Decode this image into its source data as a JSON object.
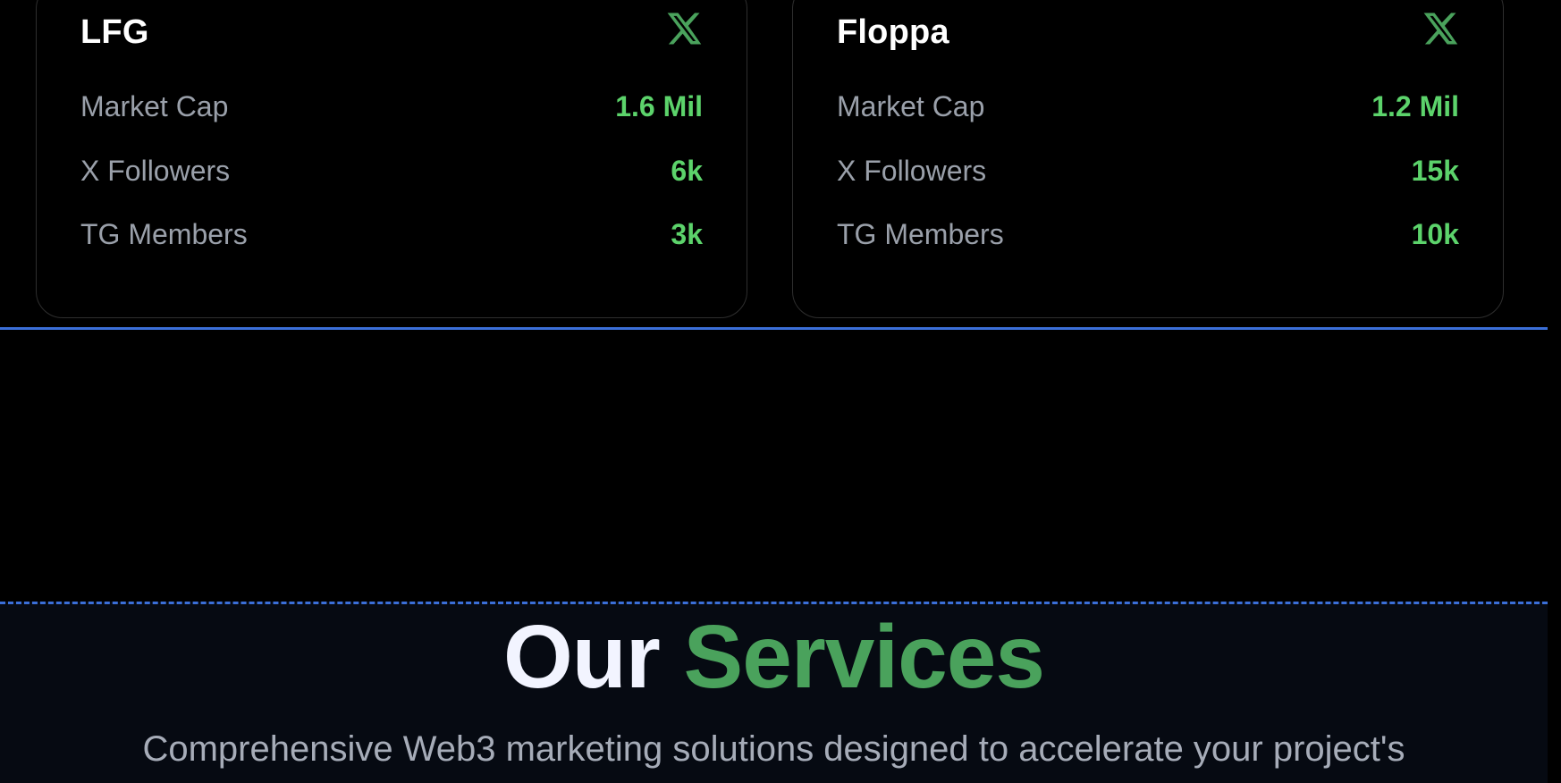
{
  "projects": [
    {
      "name": "LFG",
      "icon": "x-logo-icon",
      "stats": [
        {
          "label": "Market Cap",
          "value": "1.6 Mil"
        },
        {
          "label": "X Followers",
          "value": "6k"
        },
        {
          "label": "TG Members",
          "value": "3k"
        }
      ]
    },
    {
      "name": "Floppa",
      "icon": "x-logo-icon",
      "stats": [
        {
          "label": "Market Cap",
          "value": "1.2 Mil"
        },
        {
          "label": "X Followers",
          "value": "15k"
        },
        {
          "label": "TG Members",
          "value": "10k"
        }
      ]
    }
  ],
  "services": {
    "title_white": "Our",
    "title_green": "Services",
    "subtitle": "Comprehensive Web3 marketing solutions designed to accelerate your project's"
  },
  "colors": {
    "accent_green": "#5cd36b",
    "title_green": "#4aa25c",
    "divider_blue": "#3b6fd8",
    "x_icon_green": "#4aa25c"
  }
}
